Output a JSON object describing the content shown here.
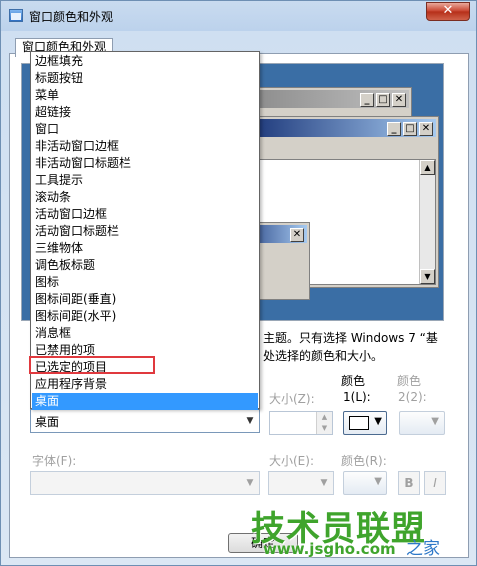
{
  "window": {
    "title": "窗口颜色和外观",
    "close_glyph": "✕"
  },
  "tab": {
    "label": "窗口颜色和外观"
  },
  "preview": {
    "inactive_buttons": [
      "_",
      "□",
      "✕"
    ],
    "active_buttons": [
      "_",
      "□",
      "✕"
    ],
    "message_close": "✕",
    "scroll_up": "▲",
    "scroll_down": "▼"
  },
  "description": {
    "line1": "主题。只有选择 Windows 7 “基",
    "line2": "处选择的颜色和大小。"
  },
  "item_row": {
    "size_label": "大小(Z):",
    "color1_label": "颜色",
    "color1_sub": "1(L):",
    "color2_label": "颜色",
    "color2_sub": "2(2):",
    "selected_value": "桌面",
    "arrow": "▼",
    "spin_up": "▲",
    "spin_down": "▼",
    "color1_value": "#ffffff"
  },
  "font_row": {
    "font_label": "字体(F):",
    "size_label": "大小(E):",
    "color_label": "颜色(R):",
    "bold": "B",
    "italic": "I",
    "arrow": "▼"
  },
  "footer": {
    "ok_label": "确定"
  },
  "dropdown": {
    "items": [
      "边框填充",
      "标题按钮",
      "菜单",
      "超链接",
      "窗口",
      "非活动窗口边框",
      "非活动窗口标题栏",
      "工具提示",
      "滚动条",
      "活动窗口边框",
      "活动窗口标题栏",
      "三维物体",
      "调色板标题",
      "图标",
      "图标间距(垂直)",
      "图标间距(水平)",
      "消息框",
      "已禁用的项",
      "已选定的项目",
      "应用程序背景",
      "桌面"
    ],
    "selected_index": 20,
    "highlighted_item": "已选定的项目"
  },
  "watermark": {
    "brand": "技术员联盟",
    "url": "www.jsgho.com",
    "suffix": "之家"
  },
  "colors": {
    "selection": "#3399ff",
    "highlight_box": "#e0393e",
    "watermark_green": "#3fa42c",
    "preview_bg": "#3a6ea5"
  }
}
